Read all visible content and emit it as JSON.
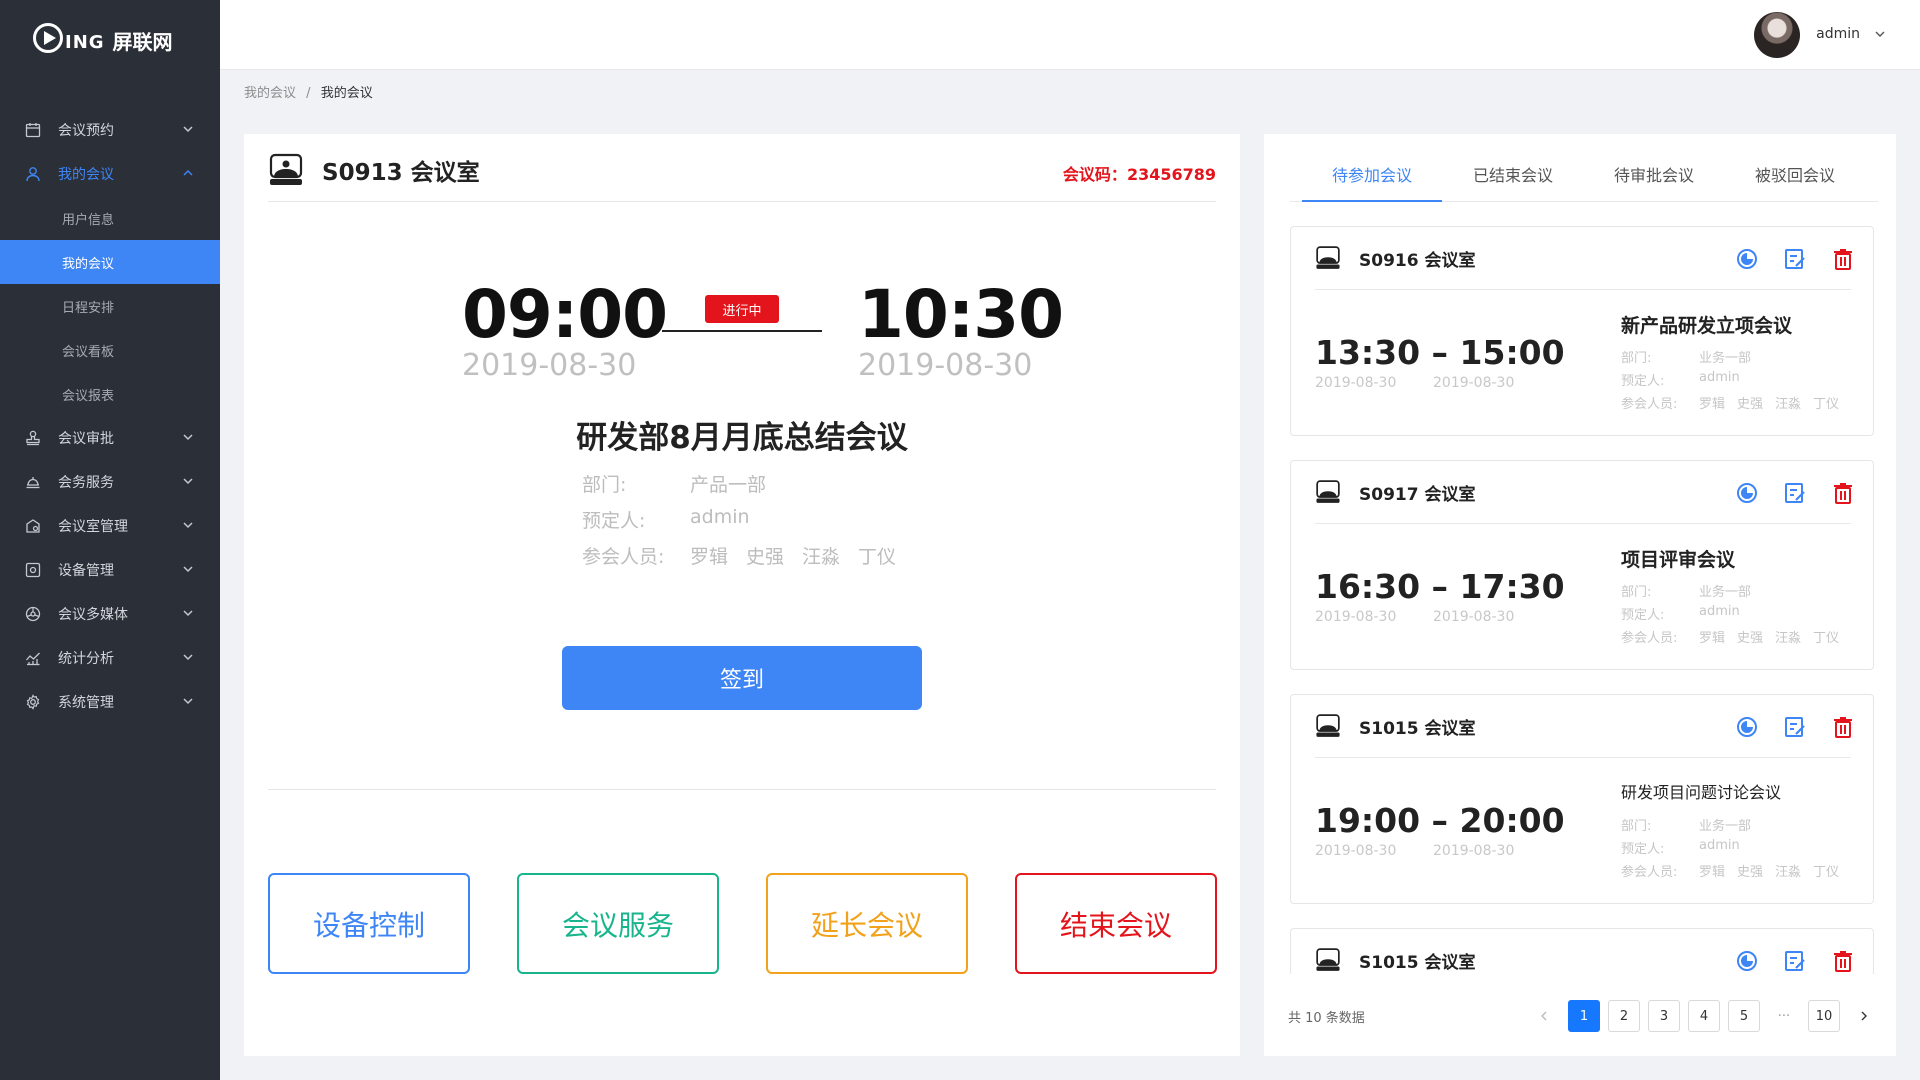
{
  "app": {
    "logo_mark": "ING",
    "logo_cn": "屏联网"
  },
  "sidebar": {
    "items": [
      {
        "label": "会议预约",
        "icon": "calendar-icon"
      },
      {
        "label": "我的会议",
        "icon": "user-icon"
      },
      {
        "label": "会议审批",
        "icon": "stamp-icon"
      },
      {
        "label": "会务服务",
        "icon": "service-icon"
      },
      {
        "label": "会议室管理",
        "icon": "room-icon"
      },
      {
        "label": "设备管理",
        "icon": "device-icon"
      },
      {
        "label": "会议多媒体",
        "icon": "media-icon"
      },
      {
        "label": "统计分析",
        "icon": "chart-icon"
      },
      {
        "label": "系统管理",
        "icon": "settings-icon"
      }
    ],
    "sub_items": [
      {
        "label": "用户信息"
      },
      {
        "label": "我的会议"
      },
      {
        "label": "日程安排"
      },
      {
        "label": "会议看板"
      },
      {
        "label": "会议报表"
      }
    ]
  },
  "header": {
    "username": "admin"
  },
  "breadcrumb": {
    "parent": "我的会议",
    "sep": "/",
    "current": "我的会议"
  },
  "current_meeting": {
    "room": "S0913 会议室",
    "code_label": "会议码：",
    "code": "23456789",
    "start_time": "09:00",
    "start_date": "2019-08-30",
    "end_time": "10:30",
    "end_date": "2019-08-30",
    "status": "进行中",
    "title": "研发部8月月底总结会议",
    "dept_label": "部门:",
    "dept": "产品一部",
    "booker_label": "预定人:",
    "booker": "admin",
    "attendees_label": "参会人员:",
    "attendees": [
      "罗辑",
      "史强",
      "汪淼",
      "丁仪"
    ],
    "checkin_label": "签到"
  },
  "actions": {
    "device": "设备控制",
    "service": "会议服务",
    "extend": "延长会议",
    "end": "结束会议"
  },
  "colors": {
    "primary": "#3e85f5",
    "green": "#18b58c",
    "orange": "#f2a11b",
    "red": "#e3141b"
  },
  "tabs": [
    "待参加会议",
    "已结束会议",
    "待审批会议",
    "被驳回会议"
  ],
  "cards": [
    {
      "room": "S0916 会议室",
      "time": "13:30 – 15:00",
      "start_date": "2019-08-30",
      "end_date": "2019-08-30",
      "name": "新产品研发立项会议",
      "dept_label": "部门:",
      "dept": "业务一部",
      "booker_label": "预定人:",
      "booker": "admin",
      "attendees_label": "参会人员:",
      "attendees": [
        "罗辑",
        "史强",
        "汪淼",
        "丁仪"
      ]
    },
    {
      "room": "S0917 会议室",
      "time": "16:30 – 17:30",
      "start_date": "2019-08-30",
      "end_date": "2019-08-30",
      "name": "项目评审会议",
      "dept_label": "部门:",
      "dept": "业务一部",
      "booker_label": "预定人:",
      "booker": "admin",
      "attendees_label": "参会人员:",
      "attendees": [
        "罗辑",
        "史强",
        "汪淼",
        "丁仪"
      ]
    },
    {
      "room": "S1015 会议室",
      "time": "19:00 – 20:00",
      "start_date": "2019-08-30",
      "end_date": "2019-08-30",
      "name": "研发项目问题讨论会议",
      "dept_label": "部门:",
      "dept": "业务一部",
      "booker_label": "预定人:",
      "booker": "admin",
      "attendees_label": "参会人员:",
      "attendees": [
        "罗辑",
        "史强",
        "汪淼",
        "丁仪"
      ]
    },
    {
      "room": "S1015 会议室"
    }
  ],
  "pagination": {
    "total_text": "共 10 条数据",
    "pages": [
      "1",
      "2",
      "3",
      "4",
      "5"
    ],
    "ellipsis": "···",
    "last": "10",
    "current": "1"
  }
}
